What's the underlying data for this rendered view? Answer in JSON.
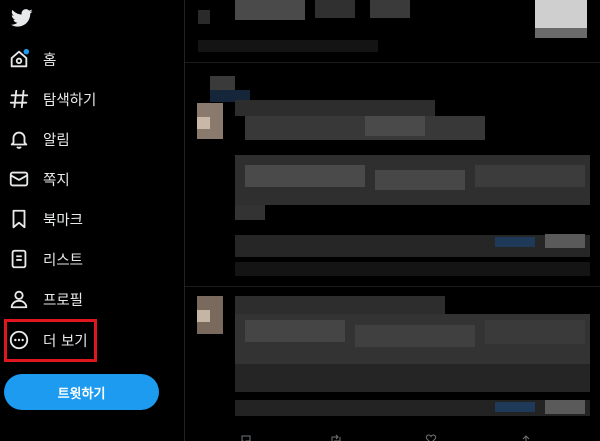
{
  "sidebar": {
    "items": [
      {
        "key": "home",
        "label": "홈",
        "icon": "home-icon",
        "has_notification_dot": true
      },
      {
        "key": "explore",
        "label": "탐색하기",
        "icon": "hashtag-icon"
      },
      {
        "key": "notifications",
        "label": "알림",
        "icon": "bell-icon"
      },
      {
        "key": "messages",
        "label": "쪽지",
        "icon": "envelope-icon"
      },
      {
        "key": "bookmarks",
        "label": "북마크",
        "icon": "bookmark-icon"
      },
      {
        "key": "lists",
        "label": "리스트",
        "icon": "list-icon"
      },
      {
        "key": "profile",
        "label": "프로필",
        "icon": "person-icon"
      },
      {
        "key": "more",
        "label": "더 보기",
        "icon": "more-circle-icon",
        "highlighted": true
      }
    ],
    "tweet_button_label": "트윗하기"
  },
  "colors": {
    "background": "#000000",
    "accent": "#1d9bf0",
    "text": "#e7e9ea",
    "highlight": "#e0161e"
  },
  "feed": {
    "pixelated": true
  }
}
